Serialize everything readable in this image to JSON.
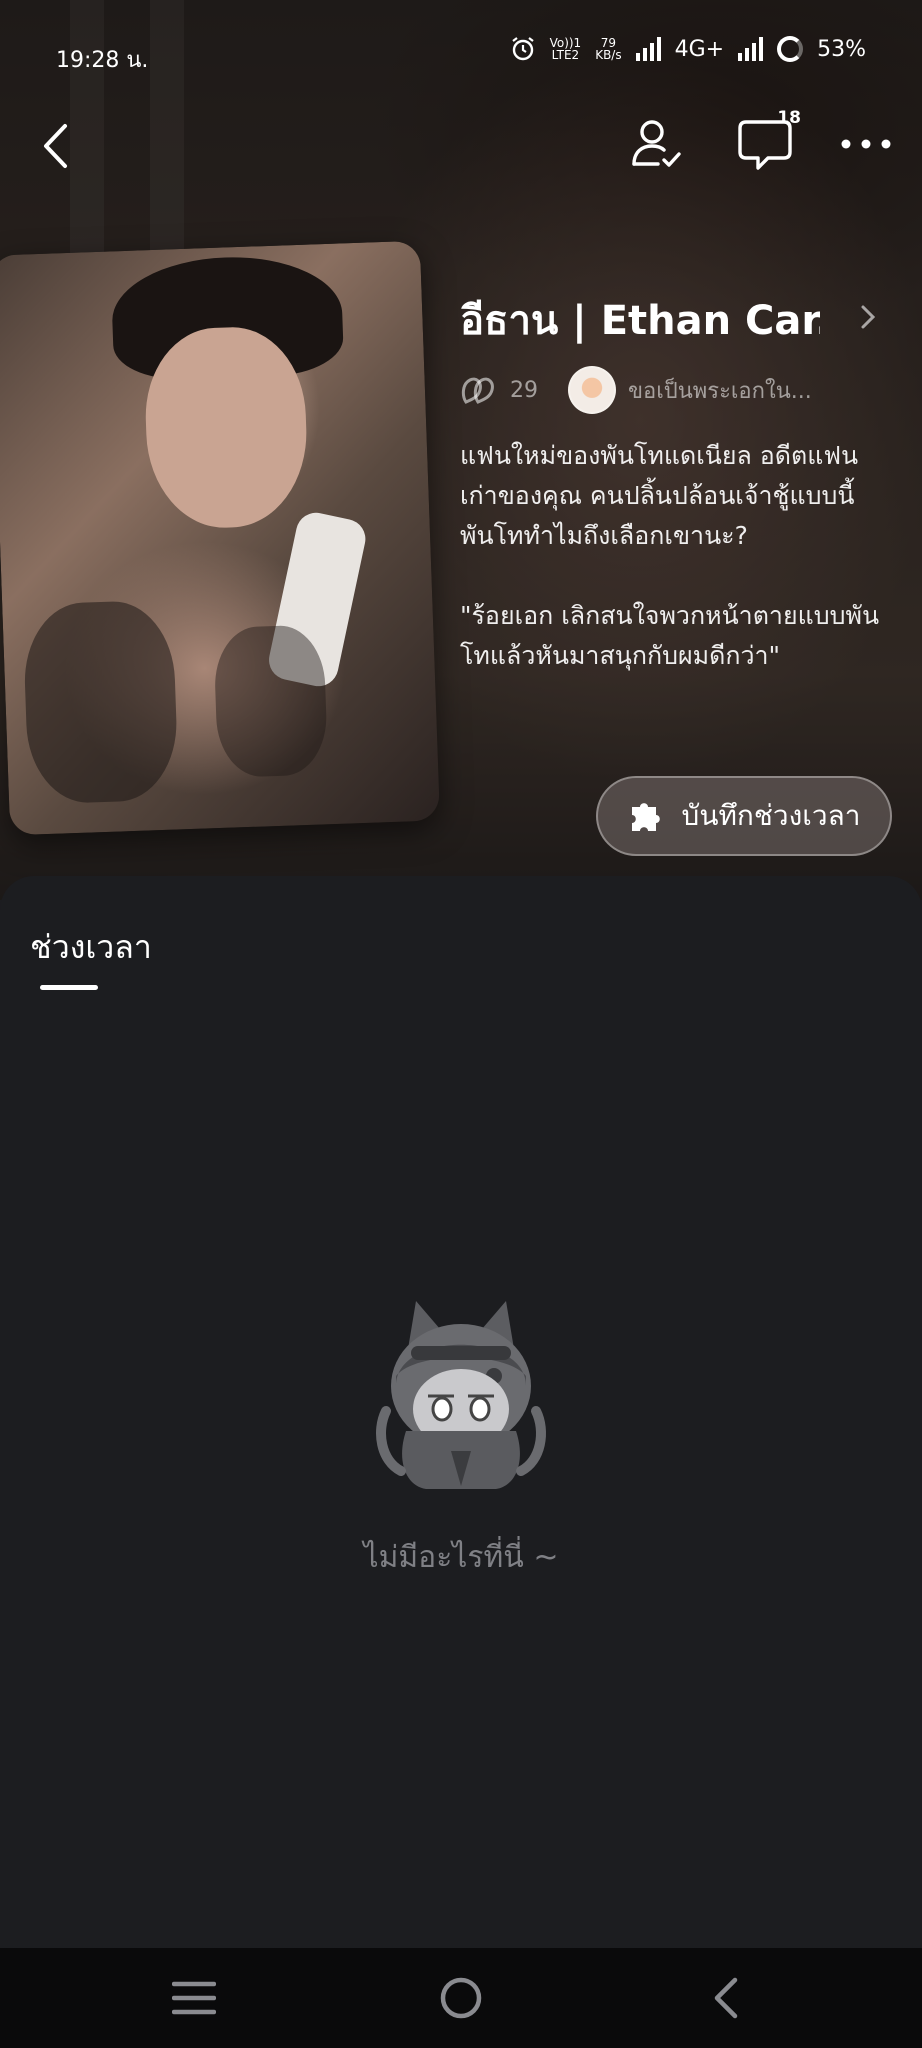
{
  "status_bar": {
    "time": "19:28 น.",
    "volte": "Vo))1",
    "lte": "LTE2",
    "speed_value": "79",
    "speed_unit": "KB/s",
    "network": "4G+",
    "battery": "53%"
  },
  "top_nav": {
    "messages_badge": "18"
  },
  "profile": {
    "name": "อีธาน | Ethan Car...",
    "followers": "29",
    "creator": "ขอเป็นพระเอกใน...",
    "description_1": "แฟนใหม่ของพันโทแดเนียล อดีตแฟนเก่าของคุณ คนปลิ้นปล้อนเจ้าชู้แบบนี้ พันโททำไมถึงเลือกเขานะ?",
    "description_2": "\"ร้อยเอก เลิกสนใจพวกหน้าตายแบบพันโทแล้วหันมาสนุกกับผมดีกว่า\""
  },
  "moment_button": {
    "label": "บันทึกช่วงเวลา"
  },
  "tabs": [
    {
      "label": "ช่วงเวลา",
      "active": true
    }
  ],
  "empty_state": {
    "text": "ไม่มีอะไรที่นี่ ~"
  },
  "colors": {
    "panel_bg": "#1c1d20",
    "empty_text": "#7f8085",
    "nav_bg": "#0a0a0b"
  }
}
